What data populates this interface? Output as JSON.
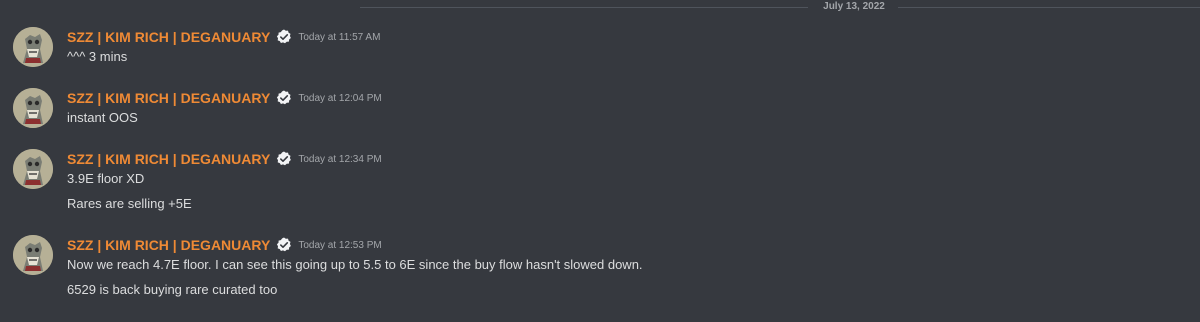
{
  "date_divider": "July 13, 2022",
  "colors": {
    "background": "#36393f",
    "username": "#ef8a35",
    "text": "#dcddde",
    "muted": "#a3a6aa"
  },
  "messages": [
    {
      "username": "SZZ | KIM RICH | DEGANUARY",
      "badge_icon": "verified-check-icon",
      "timestamp": "Today at 11:57 AM",
      "lines": [
        "^^^ 3 mins"
      ]
    },
    {
      "username": "SZZ | KIM RICH | DEGANUARY",
      "badge_icon": "verified-check-icon",
      "timestamp": "Today at 12:04 PM",
      "lines": [
        "instant OOS"
      ]
    },
    {
      "username": "SZZ | KIM RICH | DEGANUARY",
      "badge_icon": "verified-check-icon",
      "timestamp": "Today at 12:34 PM",
      "lines": [
        "3.9E floor XD",
        "Rares are selling +5E"
      ]
    },
    {
      "username": "SZZ | KIM RICH | DEGANUARY",
      "badge_icon": "verified-check-icon",
      "timestamp": "Today at 12:53 PM",
      "lines": [
        "Now we reach 4.7E floor. I can see this going up to 5.5 to 6E since the buy flow hasn't slowed down.",
        "6529 is back buying rare curated too"
      ]
    }
  ]
}
